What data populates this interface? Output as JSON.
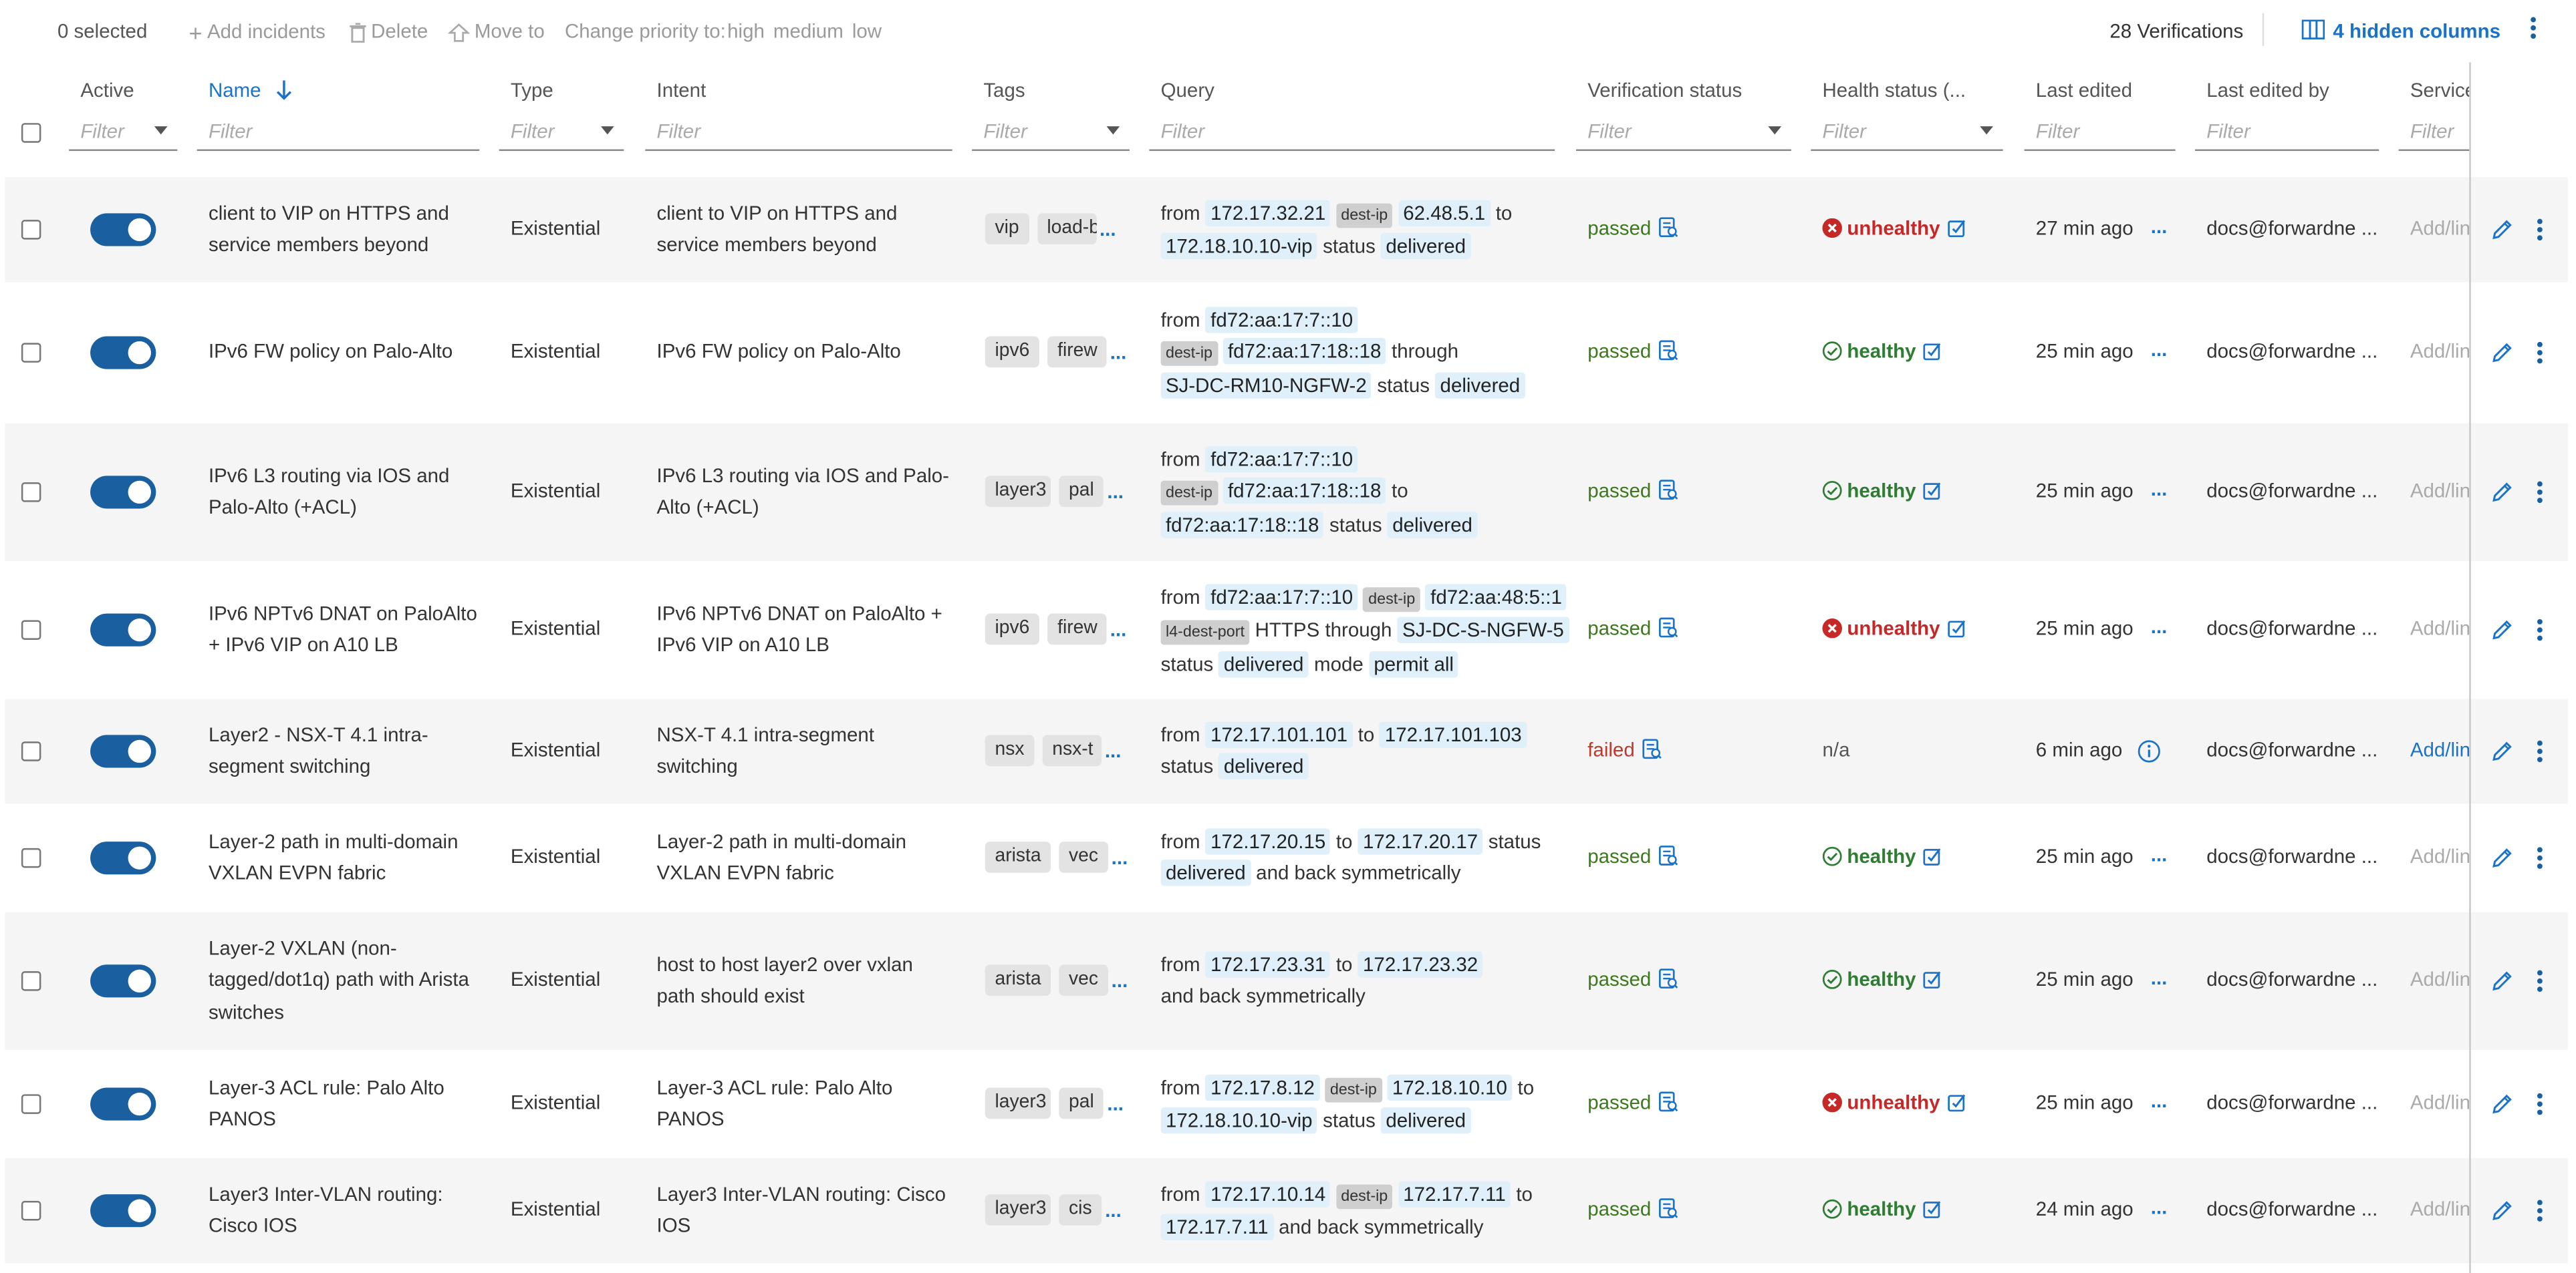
{
  "toolbar": {
    "selected": "0 selected",
    "add": "Add incidents",
    "delete": "Delete",
    "move": "Move to",
    "change_priority": "Change priority to:",
    "priorities": [
      "high",
      "medium",
      "low"
    ],
    "count": "28 Verifications",
    "hidden_columns": "4 hidden columns"
  },
  "columns": {
    "active": "Active",
    "name": "Name",
    "type": "Type",
    "intent": "Intent",
    "tags": "Tags",
    "query": "Query",
    "verification_status": "Verification status",
    "health_status": "Health status (...",
    "last_edited": "Last edited",
    "last_edited_by": "Last edited by",
    "service": "Service"
  },
  "filter_placeholder": "Filter",
  "accent_color": "#1a73c8",
  "rows": [
    {
      "name_lines": [
        "client to VIP on HTTPS and",
        "service members beyond"
      ],
      "type": "Existential",
      "intent_lines": [
        "client to VIP on HTTPS and",
        "service members beyond"
      ],
      "tags": [
        "vip",
        "load-b"
      ],
      "query": [
        [
          [
            "t",
            "from"
          ],
          [
            "v",
            "172.17.32.21"
          ],
          [
            "k",
            "dest-ip"
          ],
          [
            "v",
            "62.48.5.1"
          ],
          [
            "t",
            "to"
          ]
        ],
        [
          [
            "v",
            "172.18.10.10-vip"
          ],
          [
            "t",
            "status"
          ],
          [
            "v",
            "delivered"
          ]
        ]
      ],
      "verification": "passed",
      "health": "unhealthy",
      "last_edited": "27 min ago",
      "last_edited_by": "docs@forwardne ...",
      "service": "Add/lin"
    },
    {
      "name_lines": [
        "IPv6 FW policy on Palo-Alto"
      ],
      "type": "Existential",
      "intent_lines": [
        "IPv6 FW policy on Palo-Alto"
      ],
      "tags": [
        "ipv6",
        "firew"
      ],
      "query": [
        [
          [
            "t",
            "from"
          ],
          [
            "v",
            "fd72:aa:17:7::10"
          ]
        ],
        [
          [
            "k",
            "dest-ip"
          ],
          [
            "v",
            "fd72:aa:17:18::18"
          ],
          [
            "t",
            "through"
          ]
        ],
        [
          [
            "v",
            "SJ-DC-RM10-NGFW-2"
          ],
          [
            "t",
            "status"
          ],
          [
            "v",
            "delivered"
          ]
        ]
      ],
      "verification": "passed",
      "health": "healthy",
      "last_edited": "25 min ago",
      "last_edited_by": "docs@forwardne ...",
      "service": "Add/lin"
    },
    {
      "name_lines": [
        "IPv6 L3 routing via IOS and",
        "Palo-Alto (+ACL)"
      ],
      "type": "Existential",
      "intent_lines": [
        "IPv6 L3 routing via IOS and Palo-",
        "Alto (+ACL)"
      ],
      "tags": [
        "layer3",
        "pal"
      ],
      "query": [
        [
          [
            "t",
            "from"
          ],
          [
            "v",
            "fd72:aa:17:7::10"
          ]
        ],
        [
          [
            "k",
            "dest-ip"
          ],
          [
            "v",
            "fd72:aa:17:18::18"
          ],
          [
            "t",
            "to"
          ]
        ],
        [
          [
            "v",
            "fd72:aa:17:18::18"
          ],
          [
            "t",
            "status"
          ],
          [
            "v",
            "delivered"
          ]
        ]
      ],
      "verification": "passed",
      "health": "healthy",
      "last_edited": "25 min ago",
      "last_edited_by": "docs@forwardne ...",
      "service": "Add/lin"
    },
    {
      "name_lines": [
        "IPv6 NPTv6 DNAT on PaloAlto",
        "+ IPv6 VIP on A10 LB"
      ],
      "type": "Existential",
      "intent_lines": [
        "IPv6 NPTv6 DNAT on PaloAlto +",
        "IPv6 VIP on A10 LB"
      ],
      "tags": [
        "ipv6",
        "firew"
      ],
      "query": [
        [
          [
            "t",
            "from"
          ],
          [
            "v",
            "fd72:aa:17:7::10"
          ],
          [
            "k",
            "dest-ip"
          ],
          [
            "v",
            "fd72:aa:48:5::1"
          ]
        ],
        [
          [
            "k",
            "l4-dest-port"
          ],
          [
            "t",
            "HTTPS"
          ],
          [
            "t",
            "through"
          ],
          [
            "v",
            "SJ-DC-S-NGFW-5"
          ]
        ],
        [
          [
            "t",
            "status"
          ],
          [
            "v",
            "delivered"
          ],
          [
            "t",
            "mode"
          ],
          [
            "v",
            "permit all"
          ]
        ]
      ],
      "verification": "passed",
      "health": "unhealthy",
      "last_edited": "25 min ago",
      "last_edited_by": "docs@forwardne ...",
      "service": "Add/lin"
    },
    {
      "name_lines": [
        "Layer2 - NSX-T 4.1 intra-",
        "segment switching"
      ],
      "type": "Existential",
      "intent_lines": [
        "NSX-T 4.1 intra-segment",
        "switching"
      ],
      "tags": [
        "nsx",
        "nsx-t"
      ],
      "query": [
        [
          [
            "t",
            "from"
          ],
          [
            "v",
            "172.17.101.101"
          ],
          [
            "t",
            "to"
          ],
          [
            "v",
            "172.17.101.103"
          ]
        ],
        [
          [
            "t",
            "status"
          ],
          [
            "v",
            "delivered"
          ]
        ]
      ],
      "verification": "failed",
      "health": "n/a",
      "last_edited": "6 min ago",
      "last_edited_by": "docs@forwardne ...",
      "service": "Add/lin"
    },
    {
      "name_lines": [
        "Layer-2 path in multi-domain",
        "VXLAN EVPN fabric"
      ],
      "type": "Existential",
      "intent_lines": [
        "Layer-2 path in multi-domain",
        "VXLAN EVPN fabric"
      ],
      "tags": [
        "arista",
        "vec"
      ],
      "query": [
        [
          [
            "t",
            "from"
          ],
          [
            "v",
            "172.17.20.15"
          ],
          [
            "t",
            "to"
          ],
          [
            "v",
            "172.17.20.17"
          ],
          [
            "t",
            "status"
          ]
        ],
        [
          [
            "v",
            "delivered"
          ],
          [
            "t",
            "and back symmetrically"
          ]
        ]
      ],
      "verification": "passed",
      "health": "healthy",
      "last_edited": "25 min ago",
      "last_edited_by": "docs@forwardne ...",
      "service": "Add/lin"
    },
    {
      "name_lines": [
        "Layer-2 VXLAN (non-",
        "tagged/dot1q) path with Arista",
        "switches"
      ],
      "type": "Existential",
      "intent_lines": [
        "host to host layer2 over vxlan",
        "path should exist"
      ],
      "tags": [
        "arista",
        "vec"
      ],
      "query": [
        [
          [
            "t",
            "from"
          ],
          [
            "v",
            "172.17.23.31"
          ],
          [
            "t",
            "to"
          ],
          [
            "v",
            "172.17.23.32"
          ]
        ],
        [
          [
            "t",
            "and back symmetrically"
          ]
        ]
      ],
      "verification": "passed",
      "health": "healthy",
      "last_edited": "25 min ago",
      "last_edited_by": "docs@forwardne ...",
      "service": "Add/lin"
    },
    {
      "name_lines": [
        "Layer-3 ACL rule: Palo Alto",
        "PANOS"
      ],
      "type": "Existential",
      "intent_lines": [
        "Layer-3 ACL rule: Palo Alto",
        "PANOS"
      ],
      "tags": [
        "layer3",
        "pal"
      ],
      "query": [
        [
          [
            "t",
            "from"
          ],
          [
            "v",
            "172.17.8.12"
          ],
          [
            "k",
            "dest-ip"
          ],
          [
            "v",
            "172.18.10.10"
          ],
          [
            "t",
            "to"
          ]
        ],
        [
          [
            "v",
            "172.18.10.10-vip"
          ],
          [
            "t",
            "status"
          ],
          [
            "v",
            "delivered"
          ]
        ]
      ],
      "verification": "passed",
      "health": "unhealthy",
      "last_edited": "25 min ago",
      "last_edited_by": "docs@forwardne ...",
      "service": "Add/lin"
    },
    {
      "name_lines": [
        "Layer3 Inter-VLAN routing:",
        "Cisco IOS"
      ],
      "type": "Existential",
      "intent_lines": [
        "Layer3 Inter-VLAN routing: Cisco",
        "IOS"
      ],
      "tags": [
        "layer3",
        "cis"
      ],
      "query": [
        [
          [
            "t",
            "from"
          ],
          [
            "v",
            "172.17.10.14"
          ],
          [
            "k",
            "dest-ip"
          ],
          [
            "v",
            "172.17.7.11"
          ],
          [
            "t",
            "to"
          ]
        ],
        [
          [
            "v",
            "172.17.7.11"
          ],
          [
            "t",
            "and back symmetrically"
          ]
        ]
      ],
      "verification": "passed",
      "health": "healthy",
      "last_edited": "24 min ago",
      "last_edited_by": "docs@forwardne ...",
      "service": "Add/lin"
    }
  ]
}
